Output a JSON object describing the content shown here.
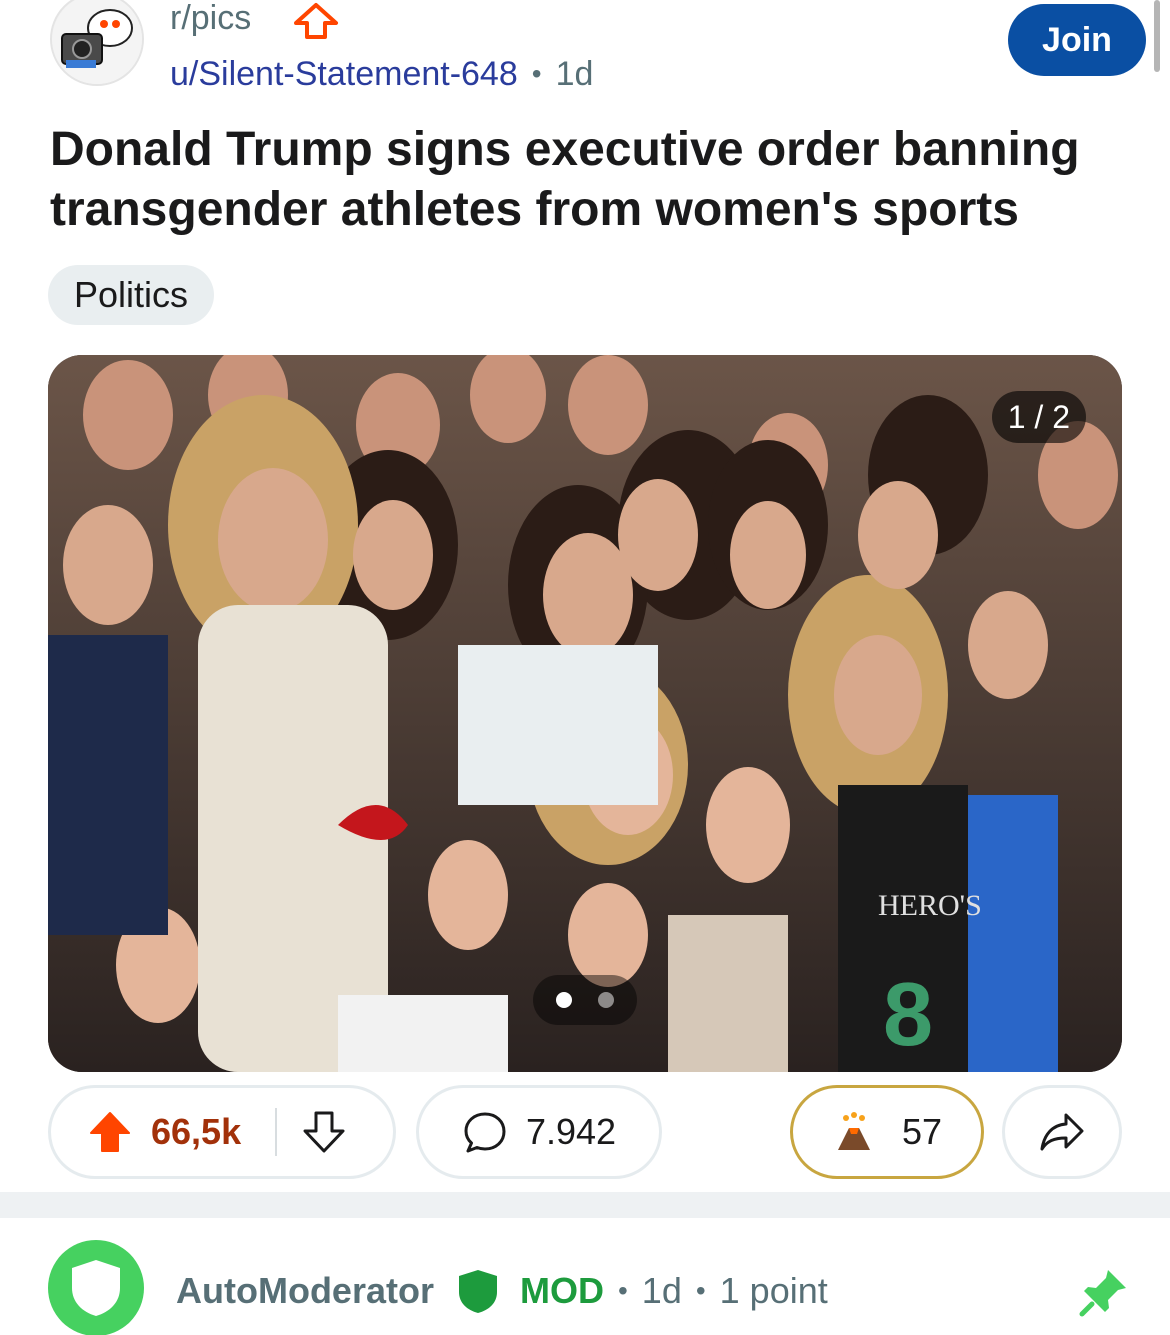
{
  "header": {
    "subreddit": "r/pics",
    "author": "u/Silent-Statement-648",
    "age": "1d",
    "join_label": "Join"
  },
  "post": {
    "title": "Donald Trump signs executive order banning transgender athletes from women's sports",
    "flair": "Politics"
  },
  "media": {
    "counter": "1 / 2",
    "page_count": 2,
    "current_page": 1
  },
  "actions": {
    "upvotes": "66,5k",
    "comments": "7.942",
    "awards": "57"
  },
  "comment": {
    "author": "AutoModerator",
    "mod_tag": "MOD",
    "age": "1d",
    "points": "1 point"
  },
  "colors": {
    "join_button": "#0a4fa3",
    "upvote_active": "#ff4500",
    "vote_count": "#a2310a",
    "mod_green": "#46d160",
    "award_border": "#c8a640",
    "author_link": "#2a3c9c"
  },
  "icons": {
    "subreddit_avatar": "snoo-camera-icon",
    "upvote_badge": "upvote-outline-icon",
    "upvote": "upvote-filled-icon",
    "downvote": "downvote-icon",
    "comment": "comment-bubble-icon",
    "award": "award-volcano-icon",
    "share": "share-arrow-icon",
    "mod_shield": "shield-icon",
    "pin": "pin-icon"
  }
}
